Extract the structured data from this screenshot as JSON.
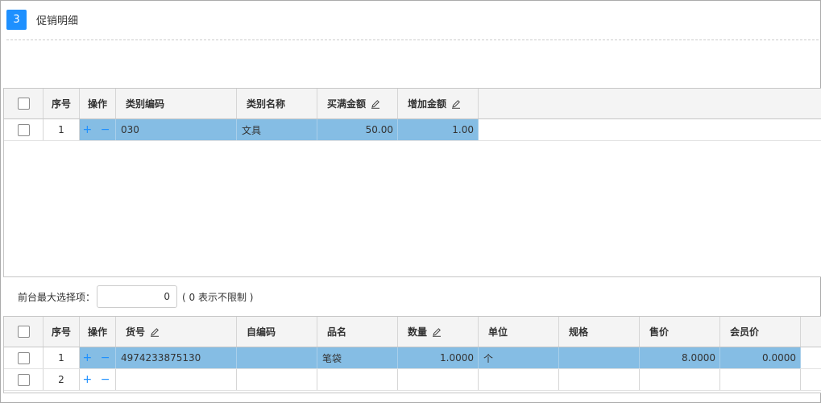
{
  "section": {
    "number": "3",
    "title": "促销明细"
  },
  "category_grid": {
    "headers": {
      "seq": "序号",
      "op": "操作",
      "code": "类别编码",
      "name": "类别名称",
      "threshold": "买满金额",
      "increase": "增加金额"
    },
    "rows": [
      {
        "seq": "1",
        "ops": "+ −",
        "code": "030",
        "name": "文具",
        "threshold": "50.00",
        "increase": "1.00",
        "selected": true
      }
    ]
  },
  "limit": {
    "label": "前台最大选择项：",
    "value": "0",
    "note": "( 0 表示不限制 )"
  },
  "item_grid": {
    "headers": {
      "seq": "序号",
      "op": "操作",
      "sku": "货号",
      "self_code": "自编码",
      "name": "品名",
      "qty": "数量",
      "unit": "单位",
      "spec": "规格",
      "price": "售价",
      "member_price": "会员价"
    },
    "rows": [
      {
        "seq": "1",
        "ops": "+ −",
        "sku": "4974233875130",
        "self_code": "",
        "name": "笔袋",
        "qty": "1.0000",
        "unit": "个",
        "spec": "",
        "price": "8.0000",
        "member_price": "0.0000",
        "selected": true
      },
      {
        "seq": "2",
        "ops": "+ −",
        "sku": "",
        "self_code": "",
        "name": "",
        "qty": "",
        "unit": "",
        "spec": "",
        "price": "",
        "member_price": "",
        "selected": false
      }
    ]
  },
  "colors": {
    "accent": "#1e90ff",
    "selected_row": "#85bde4",
    "header_bg": "#f4f4f4"
  }
}
